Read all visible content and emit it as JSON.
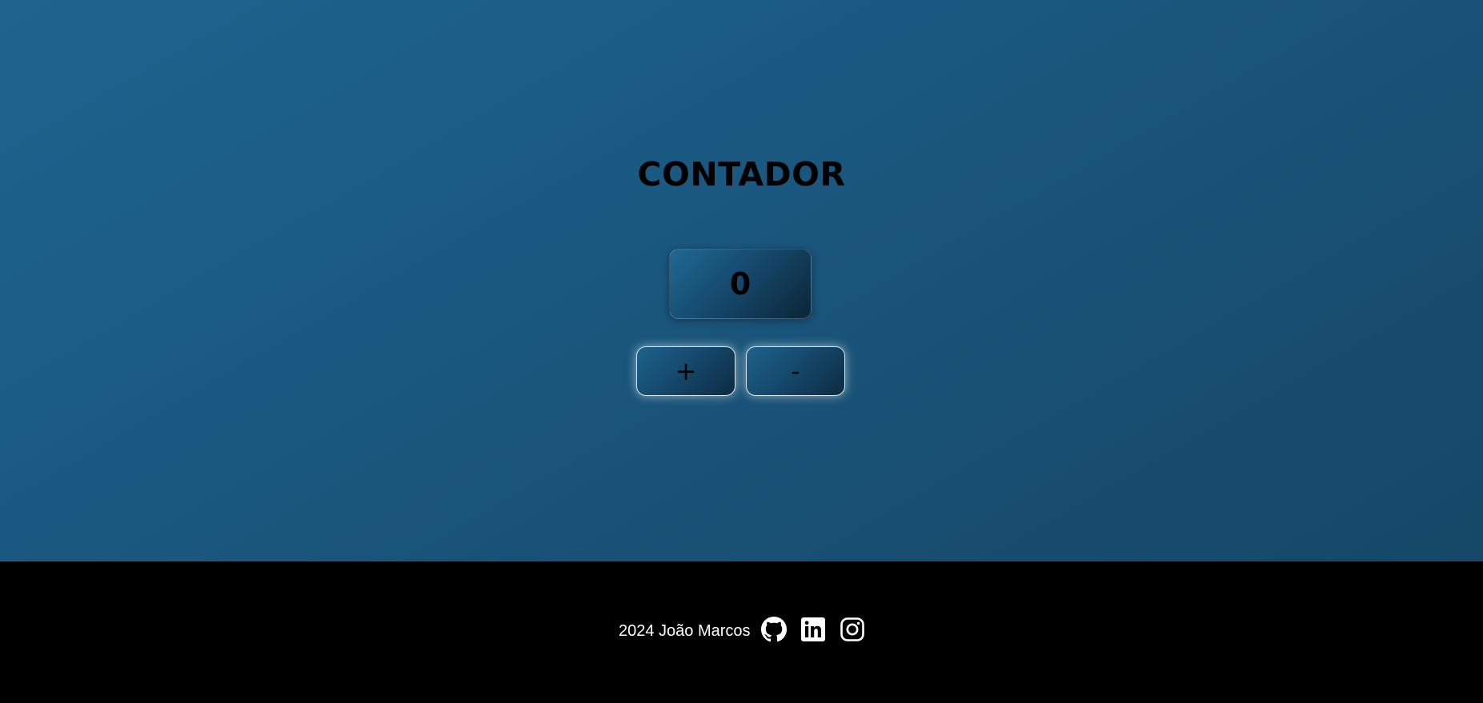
{
  "app": {
    "title": "CONTADOR"
  },
  "counter": {
    "value": "0"
  },
  "controls": {
    "increment_label": "+",
    "decrement_label": "-"
  },
  "footer": {
    "text": "2024 João Marcos",
    "links": [
      {
        "icon": "github-icon"
      },
      {
        "icon": "linkedin-icon"
      },
      {
        "icon": "instagram-icon"
      }
    ]
  },
  "colors": {
    "background_gradient_start": "#1e648f",
    "background_gradient_end": "#164767",
    "footer_background": "#000000",
    "button_border": "#d8e6ef",
    "text": "#000000",
    "footer_text": "#ffffff"
  }
}
